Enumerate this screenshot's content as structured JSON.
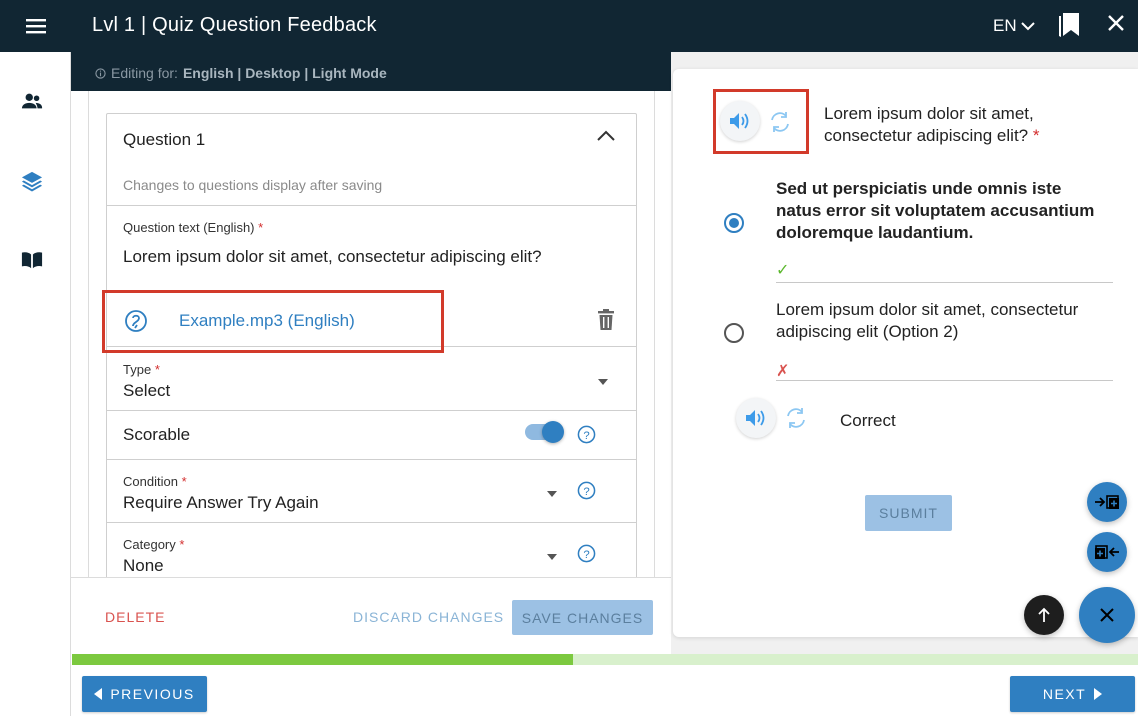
{
  "header": {
    "title": "Lvl 1 | Quiz Question Feedback",
    "language": "EN",
    "bg_color": "#112633"
  },
  "subbar": {
    "prefix": "Editing for:",
    "context": "English | Desktop | Light Mode"
  },
  "nav_rail": {
    "icons": [
      "menu-icon",
      "users-icon",
      "layers-icon",
      "book-icon"
    ]
  },
  "editor": {
    "question_heading": "Question 1",
    "hint": "Changes to questions display after saving",
    "question_text_label": "Question text (English)",
    "question_text_value": "Lorem ipsum dolor sit amet, consectetur adipiscing elit?",
    "audio_file": "Example.mp3 (English)",
    "type_label": "Type",
    "type_value": "Select",
    "scorable_label": "Scorable",
    "scorable_on": true,
    "condition_label": "Condition",
    "condition_value": "Require Answer Try Again",
    "category_label": "Category",
    "category_value": "None",
    "required_mark": "*"
  },
  "actions": {
    "delete": "DELETE",
    "discard": "DISCARD CHANGES",
    "save": "SAVE CHANGES"
  },
  "preview": {
    "question": "Lorem ipsum dolor sit amet, consectetur adipiscing elit?",
    "required_mark": "*",
    "options": [
      {
        "text": "Sed ut perspiciatis unde omnis iste natus error sit voluptatem accusantium doloremque laudantium.",
        "selected": true,
        "mark": "✓",
        "mark_color": "#5cb82e"
      },
      {
        "text": "Lorem ipsum dolor sit amet, consectetur adipiscing elit (Option 2)",
        "selected": false,
        "mark": "✗",
        "mark_color": "#d9534f"
      }
    ],
    "feedback": "Correct",
    "submit": "SUBMIT"
  },
  "progress": {
    "fraction": 0.47
  },
  "footer": {
    "previous": "PREVIOUS",
    "next": "NEXT"
  },
  "colors": {
    "accent": "#2f7fc1",
    "highlight": "#d23a2a",
    "progress": "#7cc93f"
  }
}
